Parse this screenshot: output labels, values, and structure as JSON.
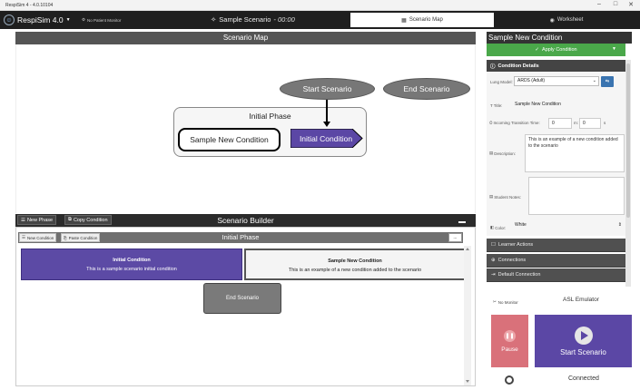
{
  "window": {
    "app_title": "RespiSim 4 - 4.0.10104",
    "controls": {
      "minimize": "–",
      "maximize": "□",
      "close": "✕"
    }
  },
  "topnav": {
    "brand": "RespiSim 4.0",
    "monitor_status": "No Patient Monitor",
    "scenario_name": "Sample Scenario",
    "scenario_time": "- 00:00",
    "tabs": {
      "scenario_map": "Scenario Map",
      "worksheet": "Worksheet"
    }
  },
  "scenario_map": {
    "header": "Scenario Map",
    "start_node": "Start Scenario",
    "end_node": "End Scenario",
    "phase_title": "Initial Phase",
    "condition_node": "Sample New Condition",
    "initial_condition_node": "Initial Condition"
  },
  "scenario_builder": {
    "header": "Scenario Builder",
    "new_phase_label": "New Phase",
    "copy_condition_label": "Copy Condition",
    "phase_name": "Initial Phase",
    "new_condition_label": "New Condition",
    "paste_condition_label": "Paste Condition",
    "phase_dropdown": "...",
    "cards": {
      "initial": {
        "title": "Initial Condition",
        "desc": "This is a sample scenario initial condition"
      },
      "sample": {
        "title": "Sample New Condition",
        "desc": "This is an example of a new condition added to the scenario"
      },
      "end": {
        "title": "End Scenario"
      }
    }
  },
  "right_panel": {
    "title": "Sample New Condition",
    "apply_label": "Apply Condition",
    "details_header": "Condition Details",
    "lung_model_label": "Lung Model:",
    "lung_model_value": "ARDS (Adult)",
    "title_label": "Title:",
    "title_value": "Sample New Condition",
    "transition_label": "Incoming Transition Time:",
    "transition_min": "0",
    "transition_min_unit": "m:",
    "transition_sec": "0",
    "transition_sec_unit": "s",
    "description_label": "Description:",
    "description_value": "This is an example of a new condition added to the scenario",
    "student_notes_label": "Student Notes:",
    "student_notes_value": "",
    "color_label": "Color:",
    "color_value": "White",
    "accordion": [
      "Learner Actions",
      "Connections",
      "Default Connection"
    ]
  },
  "bottom_panel": {
    "no_monitor": "No Monitor",
    "asl_emulator": "ASL Emulator",
    "pause_label": "Pause",
    "start_label": "Start Scenario",
    "connection_status": "Connected"
  },
  "colors": {
    "purple": "#5b47a5",
    "green": "#4aa84a",
    "pause_red": "#d9717a",
    "dark_header": "#555555"
  }
}
